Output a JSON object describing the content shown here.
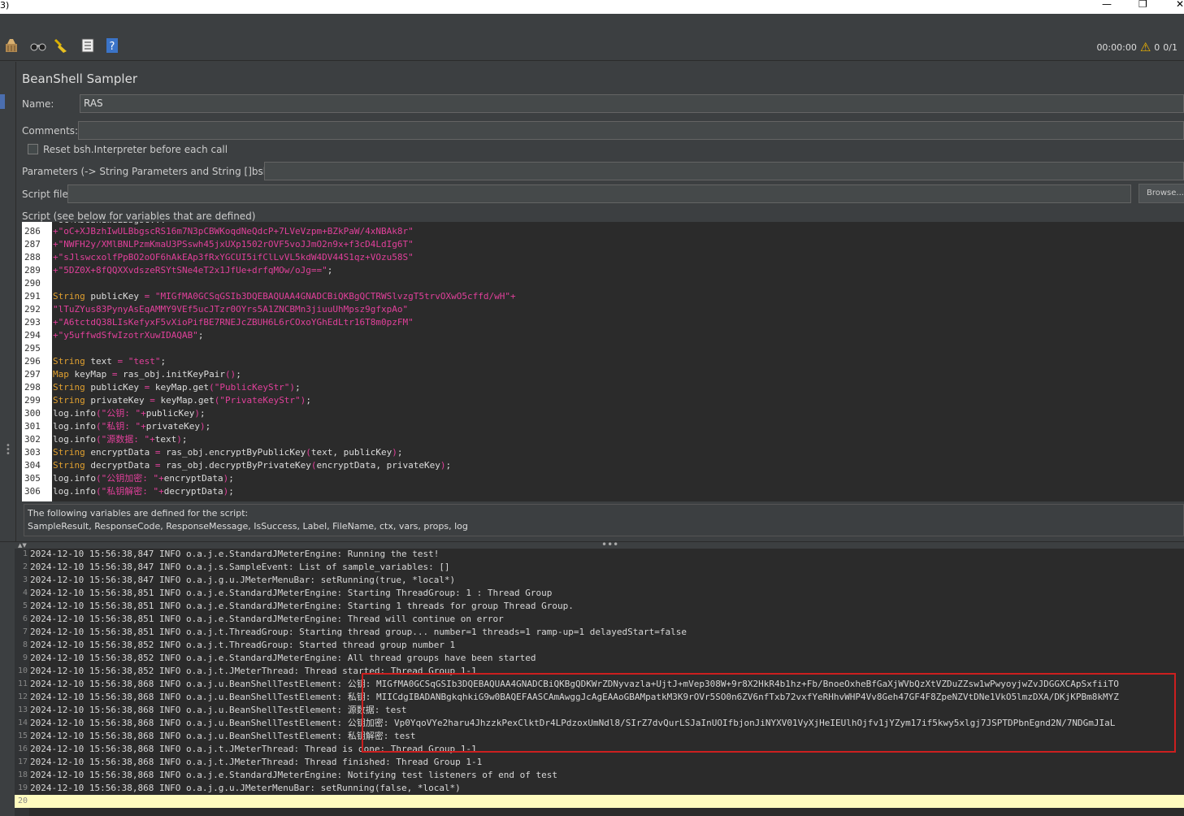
{
  "window": {
    "title_fragment": "3)",
    "minimize": "—",
    "maximize": "❐",
    "close": "✕"
  },
  "toolbar": {
    "icons": [
      "broom-icon",
      "binoculars-icon",
      "clear-broom-icon",
      "function-helper-icon",
      "help-icon"
    ],
    "timer": "00:00:00",
    "warnings": "0",
    "threads": "0/1"
  },
  "sampler": {
    "title": "BeanShell Sampler",
    "name_label": "Name:",
    "name_value": "RAS",
    "comments_label": "Comments:",
    "comments_value": "",
    "reset_label": "Reset bsh.Interpreter before each call",
    "params_label": "Parameters (-> String Parameters and String []bsh.args)",
    "params_value": "",
    "script_file_label": "Script file",
    "script_file_value": "",
    "browse_label": "Browse...",
    "script_label": "Script (see below for variables that are defined)"
  },
  "script": {
    "partial_top": "\"oC+XJ8zh1wuLBbgsc...\"",
    "lines": [
      {
        "n": "286",
        "parts": [
          [
            "st",
            "+\"oC+XJBzhIwULBbgscRS16m7N3pCBWKoqdNeQdcP+7LVeVzpm+BZkPaW/4xNBAk8r\""
          ]
        ]
      },
      {
        "n": "287",
        "parts": [
          [
            "st",
            "+\"NWFH2y/XMlBNLPzmKmaU3PSswh45jxUXp1502rOVF5voJJmO2n9x+f3cD4LdIg6T\""
          ]
        ]
      },
      {
        "n": "288",
        "parts": [
          [
            "st",
            "+\"sJlswcxolfPpBO2oOF6hAkEAp3fRxYGCUI5ifClLvVL5kdW4DV44S1qz+VOzu58S\""
          ]
        ]
      },
      {
        "n": "289",
        "parts": [
          [
            "st",
            "+\"5DZ0X+8fQQXXvdszeRSYtSNe4eT2x1JfUe+drfqMOw/oJg==\""
          ],
          [
            "tx",
            ";"
          ]
        ]
      },
      {
        "n": "290",
        "parts": []
      },
      {
        "n": "291",
        "parts": [
          [
            "kw",
            "String"
          ],
          [
            "tx",
            " publicKey "
          ],
          [
            "st",
            "= \"MIGfMA0GCSqGSIb3DQEBAQUAA4GNADCBiQKBgQCTRWSlvzgT5trvOXwO5cffd/wH\"+"
          ]
        ]
      },
      {
        "n": "292",
        "parts": [
          [
            "st",
            "\"lTuZYus83PynyAsEqAMMY9VEf5ucJTzr0OYrs5A1ZNCBMn3jiuuUhMpsz9gfxpAo\""
          ]
        ]
      },
      {
        "n": "293",
        "parts": [
          [
            "st",
            "+\"A6tctdQ38LIsKefyxF5vXioPifBE7RNEJcZBUH6L6rCOxoYGhEdLtr16T8m0pzFM\""
          ]
        ]
      },
      {
        "n": "294",
        "parts": [
          [
            "st",
            "+\"y5uffwdSfwIzotrXuwIDAQAB\""
          ],
          [
            "tx",
            ";"
          ]
        ]
      },
      {
        "n": "295",
        "parts": []
      },
      {
        "n": "296",
        "parts": [
          [
            "kw",
            "String"
          ],
          [
            "tx",
            " text "
          ],
          [
            "st",
            "= \"test\""
          ],
          [
            "tx",
            ";"
          ]
        ]
      },
      {
        "n": "297",
        "parts": [
          [
            "kw",
            "Map"
          ],
          [
            "tx",
            " keyMap "
          ],
          [
            "st",
            "="
          ],
          [
            "tx",
            " ras_obj.initKeyPair"
          ],
          [
            "st",
            "()"
          ],
          [
            "tx",
            ";"
          ]
        ]
      },
      {
        "n": "298",
        "parts": [
          [
            "kw",
            "String"
          ],
          [
            "tx",
            " publicKey "
          ],
          [
            "st",
            "="
          ],
          [
            "tx",
            " keyMap.get"
          ],
          [
            "st",
            "(\"PublicKeyStr\")"
          ],
          [
            "tx",
            ";"
          ]
        ]
      },
      {
        "n": "299",
        "parts": [
          [
            "kw",
            "String"
          ],
          [
            "tx",
            " privateKey "
          ],
          [
            "st",
            "="
          ],
          [
            "tx",
            " keyMap.get"
          ],
          [
            "st",
            "(\"PrivateKeyStr\")"
          ],
          [
            "tx",
            ";"
          ]
        ]
      },
      {
        "n": "300",
        "parts": [
          [
            "tx",
            "log.info"
          ],
          [
            "st",
            "(\"公钥: \"+"
          ],
          [
            "tx",
            "publicKey"
          ],
          [
            "st",
            ")"
          ],
          [
            "tx",
            ";"
          ]
        ]
      },
      {
        "n": "301",
        "parts": [
          [
            "tx",
            "log.info"
          ],
          [
            "st",
            "(\"私钥: \"+"
          ],
          [
            "tx",
            "privateKey"
          ],
          [
            "st",
            ")"
          ],
          [
            "tx",
            ";"
          ]
        ]
      },
      {
        "n": "302",
        "parts": [
          [
            "tx",
            "log.info"
          ],
          [
            "st",
            "(\"源数据: \"+"
          ],
          [
            "tx",
            "text"
          ],
          [
            "st",
            ")"
          ],
          [
            "tx",
            ";"
          ]
        ]
      },
      {
        "n": "303",
        "parts": [
          [
            "kw",
            "String"
          ],
          [
            "tx",
            " encryptData "
          ],
          [
            "st",
            "="
          ],
          [
            "tx",
            " ras_obj.encryptByPublicKey"
          ],
          [
            "st",
            "("
          ],
          [
            "tx",
            "text, publicKey"
          ],
          [
            "st",
            ")"
          ],
          [
            "tx",
            ";"
          ]
        ]
      },
      {
        "n": "304",
        "parts": [
          [
            "kw",
            "String"
          ],
          [
            "tx",
            " decryptData "
          ],
          [
            "st",
            "="
          ],
          [
            "tx",
            " ras_obj.decryptByPrivateKey"
          ],
          [
            "st",
            "("
          ],
          [
            "tx",
            "encryptData, privateKey"
          ],
          [
            "st",
            ")"
          ],
          [
            "tx",
            ";"
          ]
        ]
      },
      {
        "n": "305",
        "parts": [
          [
            "tx",
            "log.info"
          ],
          [
            "st",
            "(\"公钥加密: \"+"
          ],
          [
            "tx",
            "encryptData"
          ],
          [
            "st",
            ")"
          ],
          [
            "tx",
            ";"
          ]
        ]
      },
      {
        "n": "306",
        "parts": [
          [
            "tx",
            "log.info"
          ],
          [
            "st",
            "(\"私钥解密: \"+"
          ],
          [
            "tx",
            "decryptData"
          ],
          [
            "st",
            ")"
          ],
          [
            "tx",
            ";"
          ]
        ]
      }
    ]
  },
  "variables_info": {
    "line1": "The following variables are defined for the script:",
    "line2": "SampleResult, ResponseCode, ResponseMessage, IsSuccess, Label, FileName, ctx, vars, props, log"
  },
  "log": {
    "lines": [
      {
        "n": "1",
        "text": "2024-12-10 15:56:38,847 INFO o.a.j.e.StandardJMeterEngine: Running the test!"
      },
      {
        "n": "2",
        "text": "2024-12-10 15:56:38,847 INFO o.a.j.s.SampleEvent: List of sample_variables: []"
      },
      {
        "n": "3",
        "text": "2024-12-10 15:56:38,847 INFO o.a.j.g.u.JMeterMenuBar: setRunning(true, *local*)"
      },
      {
        "n": "4",
        "text": "2024-12-10 15:56:38,851 INFO o.a.j.e.StandardJMeterEngine: Starting ThreadGroup: 1 : Thread Group"
      },
      {
        "n": "5",
        "text": "2024-12-10 15:56:38,851 INFO o.a.j.e.StandardJMeterEngine: Starting 1 threads for group Thread Group."
      },
      {
        "n": "6",
        "text": "2024-12-10 15:56:38,851 INFO o.a.j.e.StandardJMeterEngine: Thread will continue on error"
      },
      {
        "n": "7",
        "text": "2024-12-10 15:56:38,851 INFO o.a.j.t.ThreadGroup: Starting thread group... number=1 threads=1 ramp-up=1 delayedStart=false"
      },
      {
        "n": "8",
        "text": "2024-12-10 15:56:38,852 INFO o.a.j.t.ThreadGroup: Started thread group number 1"
      },
      {
        "n": "9",
        "text": "2024-12-10 15:56:38,852 INFO o.a.j.e.StandardJMeterEngine: All thread groups have been started"
      },
      {
        "n": "10",
        "text": "2024-12-10 15:56:38,852 INFO o.a.j.t.JMeterThread: Thread started: Thread Group 1-1"
      },
      {
        "n": "11",
        "text": "2024-12-10 15:56:38,868 INFO o.a.j.u.BeanShellTestElement: 公钥: MIGfMA0GCSqGSIb3DQEBAQUAA4GNADCBiQKBgQDKWrZDNyvazla+UjtJ+mVep308W+9r8X2HkR4b1hz+Fb/BnoeOxheBfGaXjWVbQzXtVZDuZZsw1wPwyoyjwZvJDGGXCApSxfiiTO"
      },
      {
        "n": "12",
        "text": "2024-12-10 15:56:38,868 INFO o.a.j.u.BeanShellTestElement: 私钥: MIICdgIBADANBgkqhkiG9w0BAQEFAASCAmAwggJcAgEAAoGBAMpatkM3K9rOVr5SO0n6ZV6nfTxb72vxfYeRHhvWHP4Vv8Geh47GF4F8ZpeNZVtDNe1VkO5lmzDXA/DKjKPBm8kMYZ"
      },
      {
        "n": "13",
        "text": "2024-12-10 15:56:38,868 INFO o.a.j.u.BeanShellTestElement: 源数据: test"
      },
      {
        "n": "14",
        "text": "2024-12-10 15:56:38,868 INFO o.a.j.u.BeanShellTestElement: 公钥加密: Vp0YqoVYe2haru4JhzzkPexClktDr4LPdzoxUmNdl8/SIrZ7dvQurLSJaInUOIfbjonJiNYXV01VyXjHeIEUlhOjfv1jYZym17if5kwy5xlgj7JSPTDPbnEgnd2N/7NDGmJIaL"
      },
      {
        "n": "15",
        "text": "2024-12-10 15:56:38,868 INFO o.a.j.u.BeanShellTestElement: 私钥解密: test"
      },
      {
        "n": "16",
        "text": "2024-12-10 15:56:38,868 INFO o.a.j.t.JMeterThread: Thread is done: Thread Group 1-1"
      },
      {
        "n": "17",
        "text": "2024-12-10 15:56:38,868 INFO o.a.j.t.JMeterThread: Thread finished: Thread Group 1-1"
      },
      {
        "n": "18",
        "text": "2024-12-10 15:56:38,868 INFO o.a.j.e.StandardJMeterEngine: Notifying test listeners of end of test"
      },
      {
        "n": "19",
        "text": "2024-12-10 15:56:38,868 INFO o.a.j.g.u.JMeterMenuBar: setRunning(false, *local*)"
      },
      {
        "n": "20",
        "text": ""
      }
    ]
  },
  "colors": {
    "background": "#3c3f41",
    "editor": "#2b2b2b",
    "keyword": "#e0a030",
    "string": "#e0409a",
    "highlight_border": "#cc1f1f",
    "current_line": "#fffbbf"
  }
}
